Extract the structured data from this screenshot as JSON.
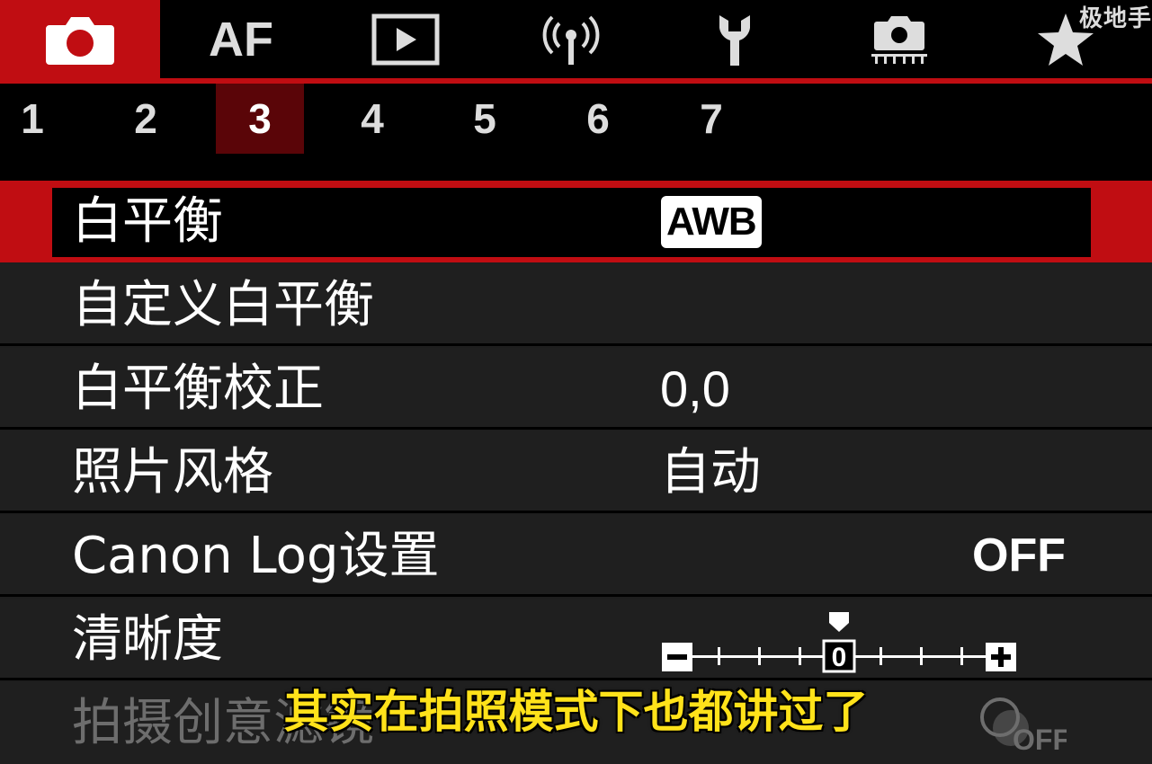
{
  "watermark": "极地手",
  "tabs": [
    {
      "name": "shooting-icon",
      "active": true
    },
    {
      "name": "af-icon",
      "label": "AF",
      "active": false
    },
    {
      "name": "playback-icon",
      "active": false
    },
    {
      "name": "wireless-icon",
      "active": false
    },
    {
      "name": "setup-wrench-icon",
      "active": false
    },
    {
      "name": "custom-camera-icon",
      "active": false
    },
    {
      "name": "my-menu-star-icon",
      "active": false
    }
  ],
  "pages": [
    "1",
    "2",
    "3",
    "4",
    "5",
    "6",
    "7"
  ],
  "active_page": "3",
  "menu": {
    "items": [
      {
        "label": "白平衡",
        "value": "AWB"
      },
      {
        "label": "自定义白平衡",
        "value": ""
      },
      {
        "label": "白平衡校正",
        "value": "0,0"
      },
      {
        "label": "照片风格",
        "value": "自动"
      },
      {
        "label": "Canon Log设置",
        "value": "OFF"
      },
      {
        "label": "清晰度",
        "value": "0",
        "scale_min": -4,
        "scale_max": 4,
        "scale_value": 0
      },
      {
        "label": "拍摄创意滤镜",
        "value": "OFF"
      }
    ]
  },
  "subtitle": "其实在拍照模式下也都讲过了",
  "colors": {
    "accent": "#c00d12",
    "subtitle": "#ffe21a",
    "row_bg": "#1f1f1f"
  }
}
